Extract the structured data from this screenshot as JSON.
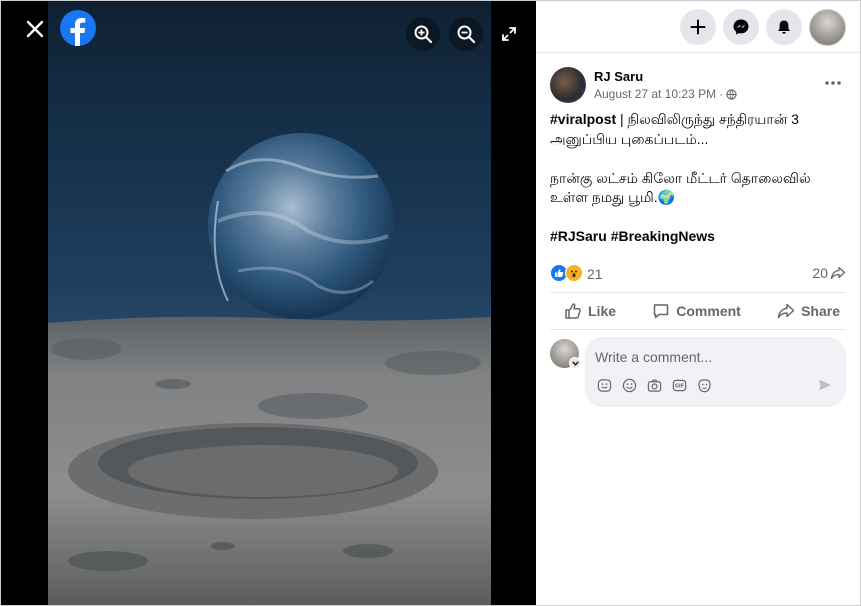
{
  "viewer": {
    "close_icon": "close-icon",
    "logo_icon": "facebook-logo-icon",
    "zoom_in_icon": "zoom-in-icon",
    "zoom_out_icon": "zoom-out-icon",
    "expand_icon": "expand-icon"
  },
  "topbar": {
    "create_icon": "plus-icon",
    "messenger_icon": "messenger-icon",
    "notifications_icon": "bell-icon",
    "profile_icon": "avatar-icon"
  },
  "post": {
    "author": "RJ Saru",
    "timestamp": "August 27 at 10:23 PM",
    "separator": "·",
    "privacy_icon": "globe-icon",
    "more_icon": "more-dots-icon",
    "line1_tag": "#viralpost",
    "line1_text": " | நிலவிலிருந்து சந்திரயான் 3 அனுப்பிய புகைப்படம்...",
    "line2_text": "நான்கு லட்சம் கிலோ மீட்டர் தொலைவில் உள்ள நமது பூமி.",
    "line2_emoji": "🌍",
    "hashtags": "#RJSaru #BreakingNews"
  },
  "reactions": {
    "count": "21",
    "shares": "20",
    "like_icon": "like-reaction-icon",
    "wow_icon": "wow-reaction-icon",
    "share_icon": "share-arrow-icon"
  },
  "actions": {
    "like": "Like",
    "comment": "Comment",
    "share": "Share"
  },
  "comment": {
    "placeholder": "Write a comment...",
    "tools": [
      "sticker-icon",
      "emoji-icon",
      "camera-icon",
      "gif-icon",
      "avatar-sticker-icon"
    ],
    "send_icon": "send-icon"
  },
  "colors": {
    "brand": "#1877f2",
    "muted_text": "#65676b",
    "button_bg": "#e4e6eb",
    "comment_bg": "#f0f2f5"
  }
}
